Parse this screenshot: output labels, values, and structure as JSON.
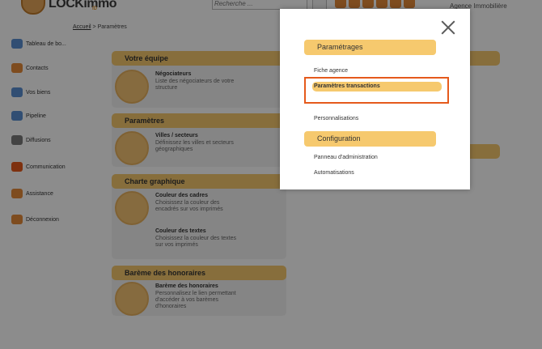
{
  "header": {
    "logo_text": "LOCKimmo",
    "logo_sub": "ID",
    "search_placeholder": "Recherche ...",
    "agency_label": "Agence Immobilière"
  },
  "breadcrumb": {
    "home": "Accueil",
    "separator": " > ",
    "current": "Paramètres"
  },
  "sidebar": {
    "items": [
      {
        "label": "Tableau de bo...",
        "icon": "dashboard-icon",
        "color": "#5a8fd1"
      },
      {
        "label": "Contacts",
        "icon": "contacts-icon",
        "color": "#e58a3a"
      },
      {
        "label": "Vos biens",
        "icon": "properties-icon",
        "color": "#5a8fd1"
      },
      {
        "label": "Pipeline",
        "icon": "pipeline-icon",
        "color": "#5a8fd1"
      },
      {
        "label": "Diffusions",
        "icon": "diffusions-icon",
        "color": "#7a7a7a"
      },
      {
        "label": "Communication",
        "icon": "communication-icon",
        "color": "#e55a1c"
      },
      {
        "label": "Assistance",
        "icon": "assistance-icon",
        "color": "#e58a3a"
      },
      {
        "label": "Déconnexion",
        "icon": "logout-icon",
        "color": "#e58a3a"
      }
    ]
  },
  "panels": [
    {
      "title": "Votre équipe",
      "cards": [
        {
          "title": "Négociateurs",
          "desc": "Liste des négociateurs de votre structure"
        }
      ]
    },
    {
      "title": "Paramètres",
      "cards": [
        {
          "title": "Villes / secteurs",
          "desc": "Définissez les villes et secteurs géographiques"
        }
      ]
    },
    {
      "title": "Charte graphique",
      "cards": [
        {
          "title": "Couleur des cadres",
          "desc": "Choisissez la couleur des encadrés sur vos imprimés"
        },
        {
          "title": "Couleur des textes",
          "desc": "Choisissez la couleur des textes sur vos imprimés"
        }
      ]
    },
    {
      "title": "Barème des honoraires",
      "cards": [
        {
          "title": "Barème des honoraires",
          "desc": "Personnalisez le lien permettant d'accéder à vos barèmes d'honoraires"
        }
      ]
    }
  ],
  "modal": {
    "sections": [
      {
        "title": "Paramétrages",
        "items": [
          "Fiche agence",
          "Paramètres transactions",
          "Personnalisations"
        ]
      },
      {
        "title": "Configuration",
        "items": [
          "Panneau d'administration",
          "Automatisations"
        ]
      }
    ],
    "active_item": "Paramètres transactions",
    "close_label": "Fermer"
  },
  "colors": {
    "accent": "#f6c96e",
    "highlight_border": "#e55a1c"
  }
}
